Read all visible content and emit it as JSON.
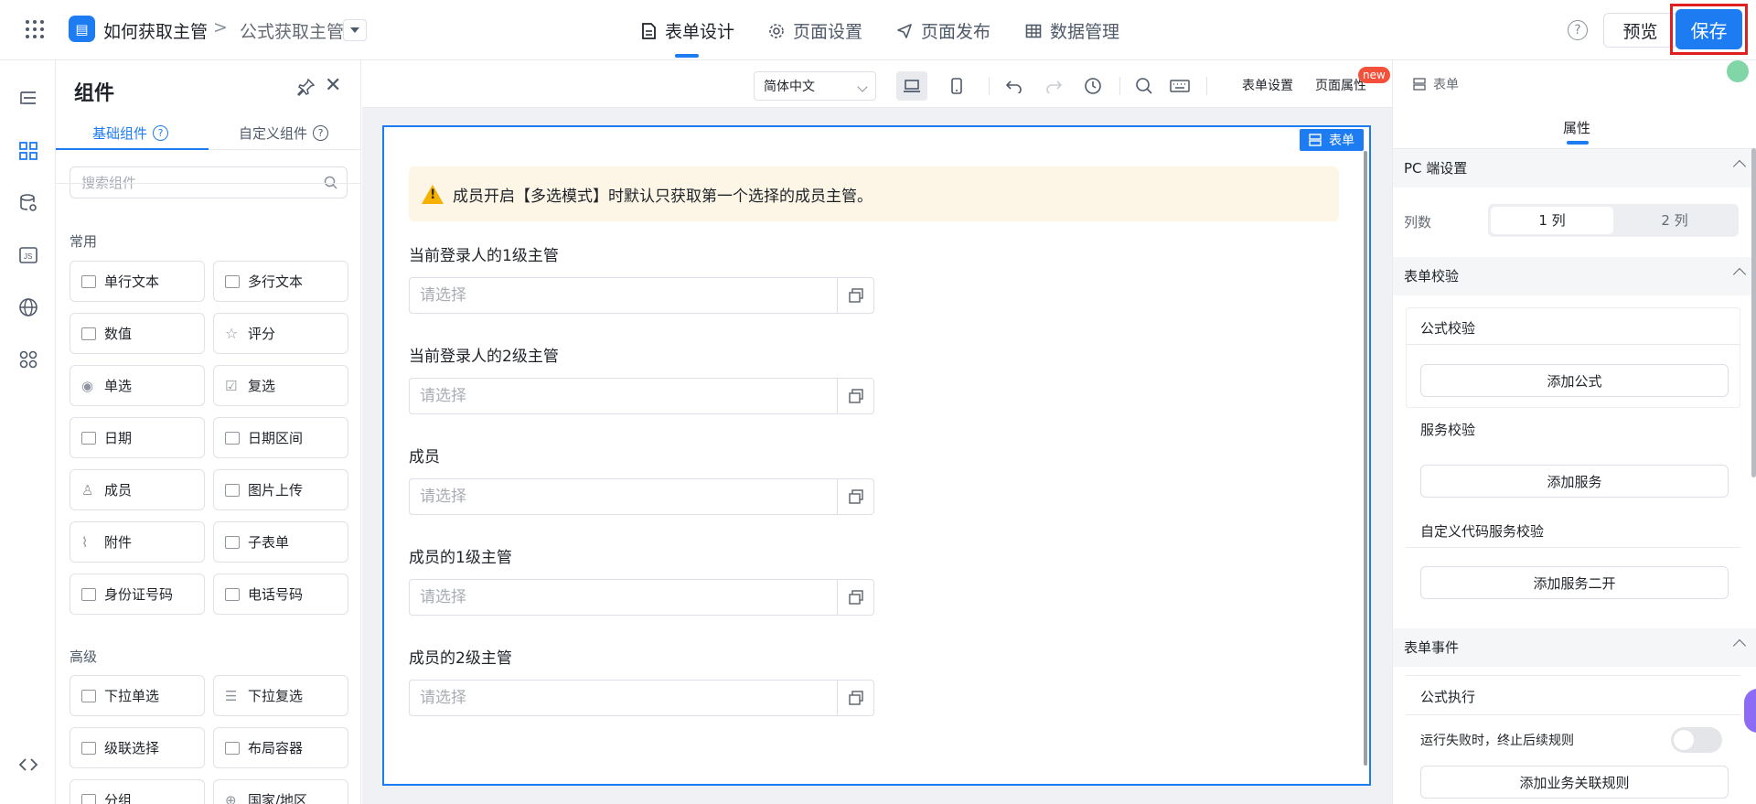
{
  "header": {
    "app_name": "如何获取主管",
    "breadcrumb_sep": ">",
    "page_name": "公式获取主管",
    "nav_tabs": [
      {
        "label": "表单设计"
      },
      {
        "label": "页面设置"
      },
      {
        "label": "页面发布"
      },
      {
        "label": "数据管理"
      }
    ],
    "help": "?",
    "preview_label": "预览",
    "save_label": "保存"
  },
  "rail": {
    "icons": [
      "outline-icon",
      "components-icon",
      "datasource-icon",
      "js-icon",
      "globe-icon",
      "apps-icon",
      "code-icon"
    ]
  },
  "panel": {
    "title": "组件",
    "tabs": [
      {
        "label": "基础组件"
      },
      {
        "label": "自定义组件"
      }
    ],
    "search_placeholder": "搜索组件",
    "groups": [
      {
        "label": "常用",
        "items": [
          "单行文本",
          "多行文本",
          "数值",
          "评分",
          "单选",
          "复选",
          "日期",
          "日期区间",
          "成员",
          "图片上传",
          "附件",
          "子表单",
          "身份证号码",
          "电话号码"
        ]
      },
      {
        "label": "高级",
        "items": [
          "下拉单选",
          "下拉复选",
          "级联选择",
          "布局容器",
          "分组",
          "国家/地区"
        ]
      }
    ]
  },
  "toolbar": {
    "language": "简体中文",
    "form_settings": "表单设置",
    "page_props": "页面属性",
    "new_badge": "new",
    "crumb": "表单"
  },
  "form": {
    "tag_label": "表单",
    "alert": "成员开启【多选模式】时默认只获取第一个选择的成员主管。",
    "fields": [
      {
        "label": "当前登录人的1级主管",
        "placeholder": "请选择"
      },
      {
        "label": "当前登录人的2级主管",
        "placeholder": "请选择"
      },
      {
        "label": "成员",
        "placeholder": "请选择"
      },
      {
        "label": "成员的1级主管",
        "placeholder": "请选择"
      },
      {
        "label": "成员的2级主管",
        "placeholder": "请选择"
      }
    ]
  },
  "props": {
    "crumb": "表单",
    "tab": "属性",
    "pc_section": "PC 端设置",
    "columns_label": "列数",
    "columns_options": [
      "1 列",
      "2 列"
    ],
    "columns_selected": "1 列",
    "validation_section": "表单校验",
    "formula_validation": "公式校验",
    "add_formula": "添加公式",
    "service_validation": "服务校验",
    "add_service": "添加服务",
    "custom_code_validation": "自定义代码服务校验",
    "add_service_two": "添加服务二开",
    "events_section": "表单事件",
    "formula_exec": "公式执行",
    "stop_on_fail": "运行失败时，终止后续规则",
    "stop_on_fail_enabled": false,
    "add_rule": "添加业务关联规则"
  },
  "colors": {
    "primary": "#1e7cf2",
    "highlight_frame": "#e02020",
    "alert_bg": "#fdf6e6",
    "warning": "#f5b000"
  }
}
